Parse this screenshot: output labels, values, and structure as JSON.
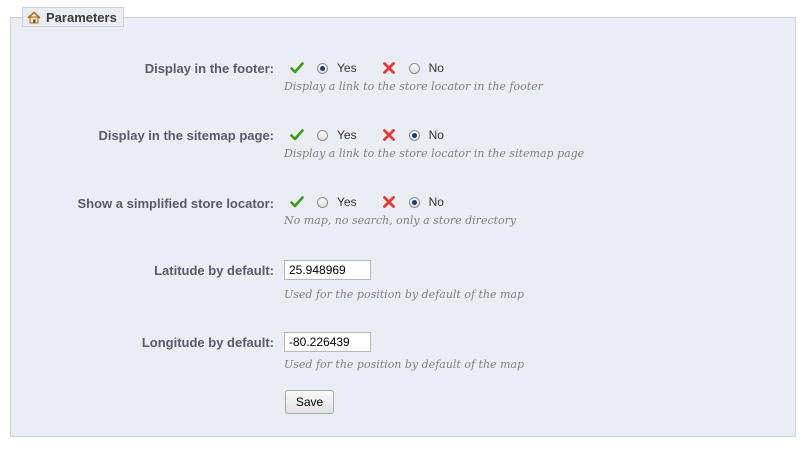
{
  "panel": {
    "title": "Parameters"
  },
  "settings": [
    {
      "label": "Display in the footer:",
      "yes": "Yes",
      "no": "No",
      "selected": "yes",
      "description": "Display a link to the store locator in the footer"
    },
    {
      "label": "Display in the sitemap page:",
      "yes": "Yes",
      "no": "No",
      "selected": "no",
      "description": "Display a link to the store locator in the sitemap page"
    },
    {
      "label": "Show a simplified store locator:",
      "yes": "Yes",
      "no": "No",
      "selected": "no",
      "description": "No map, no search, only a store directory"
    }
  ],
  "latitude": {
    "label": "Latitude by default:",
    "value": "25.948969",
    "description": "Used for the position by default of the map"
  },
  "longitude": {
    "label": "Longitude by default:",
    "value": "-80.226439",
    "description": "Used for the position by default of the map"
  },
  "save_label": "Save",
  "icons": {
    "legend": "home-icon",
    "yes": "checkmark-icon",
    "no": "cross-icon"
  },
  "colors": {
    "yes_icon": "#3c9b17",
    "no_icon": "#e03a3a",
    "panel_bg": "#ebedf4"
  }
}
